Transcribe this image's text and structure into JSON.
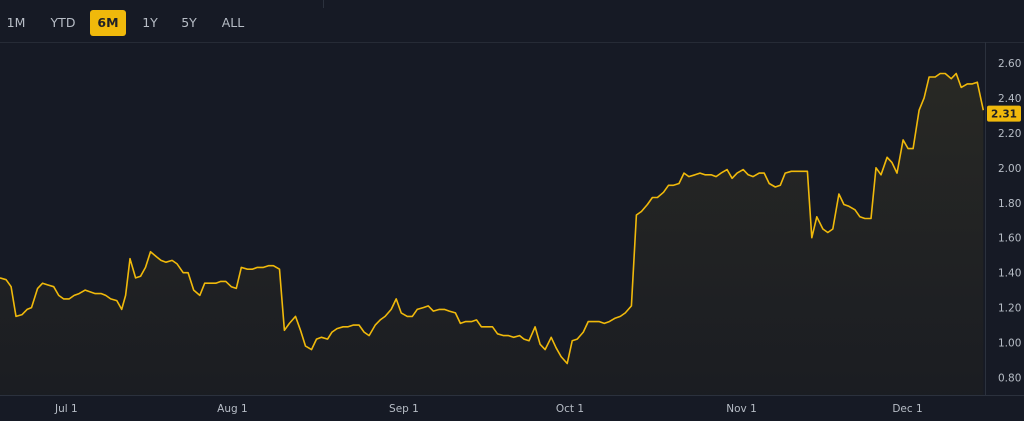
{
  "toolbar": {
    "ranges": [
      {
        "label": "1M",
        "active": false
      },
      {
        "label": "YTD",
        "active": false
      },
      {
        "label": "6M",
        "active": true
      },
      {
        "label": "1Y",
        "active": false
      },
      {
        "label": "5Y",
        "active": false
      },
      {
        "label": "ALL",
        "active": false
      }
    ]
  },
  "colors": {
    "background": "#161a25",
    "line": "#f0b90b",
    "active_button": "#f0b90b",
    "axis_text": "#b7bdc6"
  },
  "chart_data": {
    "type": "area",
    "title": "",
    "xlabel": "",
    "ylabel": "",
    "ylim": [
      0.7,
      2.72
    ],
    "y_ticks": [
      "0.80",
      "1.00",
      "1.20",
      "1.40",
      "1.60",
      "1.80",
      "2.00",
      "2.20",
      "2.40",
      "2.60"
    ],
    "x_ticks": [
      "Jul 1",
      "Aug 1",
      "Sep 1",
      "Oct 1",
      "Nov 1",
      "Dec 1"
    ],
    "x_tick_days": [
      0,
      30,
      61,
      91,
      122,
      152
    ],
    "x_range_days": [
      -12,
      166
    ],
    "last_price_label": "2.31",
    "last_price": 2.31,
    "grid": false,
    "series": [
      {
        "x_days": [
          -12.0,
          -10.9,
          -10.0,
          -9.1,
          -8.0,
          -7.1,
          -6.3,
          -5.2,
          -4.3,
          -3.4,
          -2.3,
          -1.4,
          -0.5,
          0.5,
          1.4,
          2.3,
          3.4,
          4.3,
          5.2,
          6.3,
          7.1,
          8.0,
          9.1,
          10.0,
          10.7,
          11.5,
          12.5,
          13.4,
          14.3,
          15.2,
          16.3,
          17.1,
          18.0,
          19.1,
          20.0,
          21.1,
          22.0,
          23.0,
          24.1,
          25.0,
          25.9,
          27.0,
          27.9,
          28.8,
          29.8,
          30.7,
          31.6,
          32.7,
          33.6,
          34.5,
          35.6,
          36.5,
          37.4,
          38.5,
          39.4,
          40.3,
          41.4,
          42.3,
          43.2,
          44.3,
          45.2,
          46.1,
          47.2,
          48.0,
          48.9,
          50.0,
          50.9,
          51.8,
          52.9,
          53.8,
          54.7,
          55.8,
          56.7,
          57.6,
          58.7,
          59.6,
          60.5,
          61.6,
          62.5,
          63.4,
          64.5,
          65.4,
          66.3,
          67.4,
          68.3,
          69.2,
          70.3,
          71.2,
          72.1,
          73.2,
          74.1,
          75.0,
          76.1,
          77.0,
          77.9,
          79.0,
          79.9,
          80.8,
          81.9,
          82.7,
          83.6,
          84.7,
          85.6,
          86.5,
          87.6,
          88.5,
          89.4,
          90.5,
          91.4,
          92.3,
          93.4,
          94.3,
          95.2,
          96.3,
          97.2,
          98.1,
          99.2,
          100.1,
          101.0,
          102.1,
          103.0,
          103.9,
          105.0,
          105.9,
          106.8,
          107.9,
          108.8,
          109.7,
          110.7,
          111.6,
          112.5,
          113.6,
          114.5,
          115.4,
          116.5,
          117.4,
          118.3,
          119.4,
          120.3,
          121.2,
          122.3,
          123.2,
          124.1,
          125.2,
          126.1,
          127.0,
          128.1,
          129.0,
          129.9,
          131.0,
          131.9,
          132.8,
          133.9,
          134.7,
          135.6,
          136.7,
          137.6,
          138.5,
          139.6,
          140.5,
          141.4,
          142.5,
          143.4,
          144.3,
          145.4,
          146.3,
          147.2,
          148.3,
          149.2,
          150.1,
          151.2,
          152.1,
          153.0,
          154.1,
          155.0,
          155.9,
          157.0,
          157.9,
          158.8,
          159.9,
          160.8,
          161.7,
          162.8,
          163.7,
          164.6,
          165.7
        ],
        "values": [
          1.37,
          1.36,
          1.32,
          1.15,
          1.16,
          1.19,
          1.2,
          1.31,
          1.34,
          1.33,
          1.32,
          1.27,
          1.25,
          1.25,
          1.27,
          1.28,
          1.3,
          1.29,
          1.28,
          1.28,
          1.27,
          1.25,
          1.24,
          1.19,
          1.27,
          1.48,
          1.37,
          1.38,
          1.43,
          1.52,
          1.49,
          1.47,
          1.46,
          1.47,
          1.45,
          1.4,
          1.4,
          1.3,
          1.27,
          1.34,
          1.34,
          1.34,
          1.35,
          1.35,
          1.32,
          1.31,
          1.43,
          1.42,
          1.42,
          1.43,
          1.43,
          1.44,
          1.44,
          1.42,
          1.07,
          1.11,
          1.15,
          1.07,
          0.98,
          0.96,
          1.02,
          1.03,
          1.02,
          1.06,
          1.08,
          1.09,
          1.09,
          1.1,
          1.1,
          1.06,
          1.04,
          1.1,
          1.13,
          1.15,
          1.19,
          1.25,
          1.17,
          1.15,
          1.15,
          1.19,
          1.2,
          1.21,
          1.18,
          1.19,
          1.19,
          1.18,
          1.17,
          1.11,
          1.12,
          1.12,
          1.13,
          1.09,
          1.09,
          1.09,
          1.05,
          1.04,
          1.04,
          1.03,
          1.04,
          1.02,
          1.01,
          1.09,
          0.99,
          0.96,
          1.03,
          0.97,
          0.92,
          0.88,
          1.01,
          1.02,
          1.06,
          1.12,
          1.12,
          1.12,
          1.11,
          1.12,
          1.14,
          1.15,
          1.17,
          1.21,
          1.73,
          1.75,
          1.79,
          1.83,
          1.83,
          1.86,
          1.9,
          1.9,
          1.91,
          1.97,
          1.95,
          1.96,
          1.97,
          1.96,
          1.96,
          1.95,
          1.97,
          1.99,
          1.94,
          1.97,
          1.99,
          1.96,
          1.95,
          1.97,
          1.97,
          1.91,
          1.89,
          1.9,
          1.97,
          1.98,
          1.98,
          1.98,
          1.98,
          1.6,
          1.72,
          1.65,
          1.63,
          1.65,
          1.85,
          1.79,
          1.78,
          1.76,
          1.72,
          1.71,
          1.71,
          2.0,
          1.96,
          2.06,
          2.03,
          1.97,
          2.16,
          2.11,
          2.11,
          2.33,
          2.4,
          2.52,
          2.52,
          2.54,
          2.54,
          2.51,
          2.54,
          2.46,
          2.48,
          2.48,
          2.49,
          2.33,
          2.34,
          2.33,
          2.35,
          2.31
        ]
      }
    ]
  }
}
